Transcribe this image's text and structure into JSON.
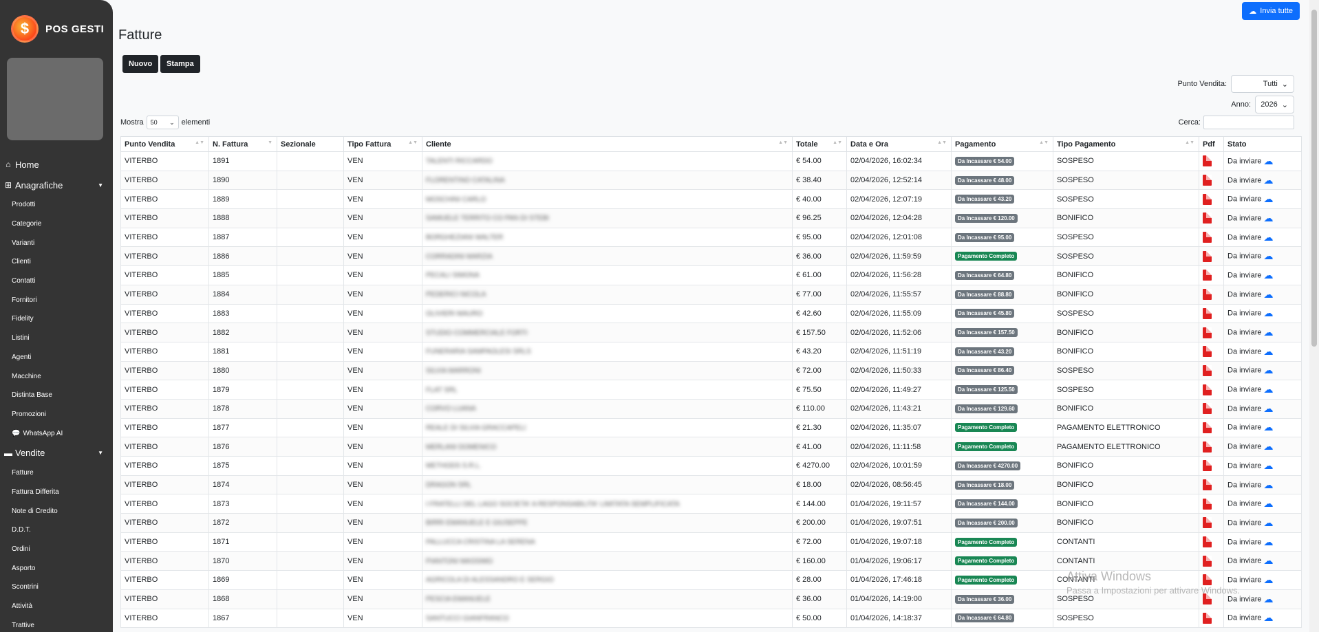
{
  "brand": {
    "name": "POS GESTI",
    "logo_symbol": "$"
  },
  "sidebar": {
    "home": "Home",
    "anagrafiche": {
      "label": "Anagrafiche",
      "items": [
        "Prodotti",
        "Categorie",
        "Varianti",
        "Clienti",
        "Contatti",
        "Fornitori",
        "Fidelity",
        "Listini",
        "Agenti",
        "Macchine",
        "Distinta Base",
        "Promozioni",
        "WhatsApp AI"
      ]
    },
    "vendite": {
      "label": "Vendite",
      "items": [
        "Fatture",
        "Fattura Differita",
        "Note di Credito",
        "D.D.T.",
        "Ordini",
        "Asporto",
        "Scontrini",
        "Attività",
        "Trattive"
      ]
    }
  },
  "header": {
    "send_all": "Invia tutte",
    "title": "Fatture",
    "new_button": "Nuovo",
    "print_button": "Stampa"
  },
  "filters": {
    "punto_vendita_label": "Punto Vendita:",
    "punto_vendita_value": "Tutti",
    "anno_label": "Anno:",
    "anno_value": "2026",
    "mostra_label": "Mostra",
    "mostra_value": "50",
    "elementi_label": "elementi",
    "cerca_label": "Cerca:"
  },
  "table": {
    "columns": [
      "Punto Vendita",
      "N. Fattura",
      "Sezionale",
      "Tipo Fattura",
      "Cliente",
      "Totale",
      "Data e Ora",
      "Pagamento",
      "Tipo Pagamento",
      "Pdf",
      "Stato"
    ],
    "rows": [
      [
        "VITERBO",
        "1891",
        "",
        "VEN",
        "TALENTI RICCARDO",
        "€ 54.00",
        "02/04/2026, 16:02:34",
        "Da Incassare € 54.00",
        "SOSPESO",
        "Da inviare"
      ],
      [
        "VITERBO",
        "1890",
        "",
        "VEN",
        "FLORENTINO CATALINA",
        "€ 38.40",
        "02/04/2026, 12:52:14",
        "Da Incassare € 48.00",
        "SOSPESO",
        "Da inviare"
      ],
      [
        "VITERBO",
        "1889",
        "",
        "VEN",
        "MOSCHINI CARLO",
        "€ 40.00",
        "02/04/2026, 12:07:19",
        "Da Incassare € 43.20",
        "SOSPESO",
        "Da inviare"
      ],
      [
        "VITERBO",
        "1888",
        "",
        "VEN",
        "SAMUELE TERRITO CO PAN DI STEBI",
        "€ 96.25",
        "02/04/2026, 12:04:28",
        "Da Incassare € 120.00",
        "BONIFICO",
        "Da inviare"
      ],
      [
        "VITERBO",
        "1887",
        "",
        "VEN",
        "BORGHEZIANI WALTER",
        "€ 95.00",
        "02/04/2026, 12:01:08",
        "Da Incassare € 95.00",
        "SOSPESO",
        "Da inviare"
      ],
      [
        "VITERBO",
        "1886",
        "",
        "VEN",
        "CORRADINI MARZIA",
        "€ 36.00",
        "02/04/2026, 11:59:59",
        "Pagamento Completo",
        "SOSPESO",
        "Da inviare"
      ],
      [
        "VITERBO",
        "1885",
        "",
        "VEN",
        "PECALI SIMONA",
        "€ 61.00",
        "02/04/2026, 11:56:28",
        "Da Incassare € 64.80",
        "BONIFICO",
        "Da inviare"
      ],
      [
        "VITERBO",
        "1884",
        "",
        "VEN",
        "PEDERICI NICOLA",
        "€ 77.00",
        "02/04/2026, 11:55:57",
        "Da Incassare € 88.80",
        "BONIFICO",
        "Da inviare"
      ],
      [
        "VITERBO",
        "1883",
        "",
        "VEN",
        "OLIVIERI MAURO",
        "€ 42.60",
        "02/04/2026, 11:55:09",
        "Da Incassare € 45.80",
        "SOSPESO",
        "Da inviare"
      ],
      [
        "VITERBO",
        "1882",
        "",
        "VEN",
        "STUDIO COMMERCIALE FORTI",
        "€ 157.50",
        "02/04/2026, 11:52:06",
        "Da Incassare € 157.50",
        "BONIFICO",
        "Da inviare"
      ],
      [
        "VITERBO",
        "1881",
        "",
        "VEN",
        "FUNERARIA SAMPAOLESI SRLS",
        "€ 43.20",
        "02/04/2026, 11:51:19",
        "Da Incassare € 43.20",
        "BONIFICO",
        "Da inviare"
      ],
      [
        "VITERBO",
        "1880",
        "",
        "VEN",
        "SILVIA MARRONI",
        "€ 72.00",
        "02/04/2026, 11:50:33",
        "Da Incassare € 86.40",
        "SOSPESO",
        "Da inviare"
      ],
      [
        "VITERBO",
        "1879",
        "",
        "VEN",
        "FLAT SRL",
        "€ 75.50",
        "02/04/2026, 11:49:27",
        "Da Incassare € 125.50",
        "SOSPESO",
        "Da inviare"
      ],
      [
        "VITERBO",
        "1878",
        "",
        "VEN",
        "CORVO LUANA",
        "€ 110.00",
        "02/04/2026, 11:43:21",
        "Da Incassare € 129.60",
        "BONIFICO",
        "Da inviare"
      ],
      [
        "VITERBO",
        "1877",
        "",
        "VEN",
        "REALE DI SILVIA GRACCAPELI",
        "€ 21.30",
        "02/04/2026, 11:35:07",
        "Pagamento Completo",
        "PAGAMENTO ELETTRONICO",
        "Da inviare"
      ],
      [
        "VITERBO",
        "1876",
        "",
        "VEN",
        "MERLANI DOMENICO",
        "€ 41.00",
        "02/04/2026, 11:11:58",
        "Pagamento Completo",
        "PAGAMENTO ELETTRONICO",
        "Da inviare"
      ],
      [
        "VITERBO",
        "1875",
        "",
        "VEN",
        "METHODS S.R.L.",
        "€ 4270.00",
        "02/04/2026, 10:01:59",
        "Da Incassare € 4270.00",
        "BONIFICO",
        "Da inviare"
      ],
      [
        "VITERBO",
        "1874",
        "",
        "VEN",
        "DRAGON SRL",
        "€ 18.00",
        "02/04/2026, 08:56:45",
        "Da Incassare € 18.00",
        "BONIFICO",
        "Da inviare"
      ],
      [
        "VITERBO",
        "1873",
        "",
        "VEN",
        "I FRATELLI DEL LAGO SOCIETA' A RESPONSABILITA' LIMITATA SEMPLIFICATA",
        "€ 144.00",
        "01/04/2026, 19:11:57",
        "Da Incassare € 144.00",
        "BONIFICO",
        "Da inviare"
      ],
      [
        "VITERBO",
        "1872",
        "",
        "VEN",
        "BIRRI EMANUELE E GIUSEPPE",
        "€ 200.00",
        "01/04/2026, 19:07:51",
        "Da Incassare € 200.00",
        "BONIFICO",
        "Da inviare"
      ],
      [
        "VITERBO",
        "1871",
        "",
        "VEN",
        "PALLUCCA CRISTINA LA SERENA",
        "€ 72.00",
        "01/04/2026, 19:07:18",
        "Pagamento Completo",
        "CONTANTI",
        "Da inviare"
      ],
      [
        "VITERBO",
        "1870",
        "",
        "VEN",
        "PIANTONI MASSIMO",
        "€ 160.00",
        "01/04/2026, 19:06:17",
        "Pagamento Completo",
        "CONTANTI",
        "Da inviare"
      ],
      [
        "VITERBO",
        "1869",
        "",
        "VEN",
        "AGRICOLA DI ALESSANDRO E SERGIO",
        "€ 28.00",
        "01/04/2026, 17:46:18",
        "Pagamento Completo",
        "CONTANTI",
        "Da inviare"
      ],
      [
        "VITERBO",
        "1868",
        "",
        "VEN",
        "PESCIA EMANUELE",
        "€ 36.00",
        "01/04/2026, 14:19:00",
        "Da Incassare € 36.00",
        "SOSPESO",
        "Da inviare"
      ],
      [
        "VITERBO",
        "1867",
        "",
        "VEN",
        "SANTUCCI GIANFRANCO",
        "€ 50.00",
        "01/04/2026, 14:18:37",
        "Da Incassare € 64.80",
        "SOSPESO",
        "Da inviare"
      ]
    ]
  },
  "watermark": {
    "line1": "Attiva Windows",
    "line2": "Passa a Impostazioni per attivare Windows."
  },
  "colors": {
    "accent": "#0d6efd",
    "sidebar": "#343434",
    "badge_pending": "#6c757d",
    "badge_paid": "#198754",
    "pdf": "#e02020"
  }
}
